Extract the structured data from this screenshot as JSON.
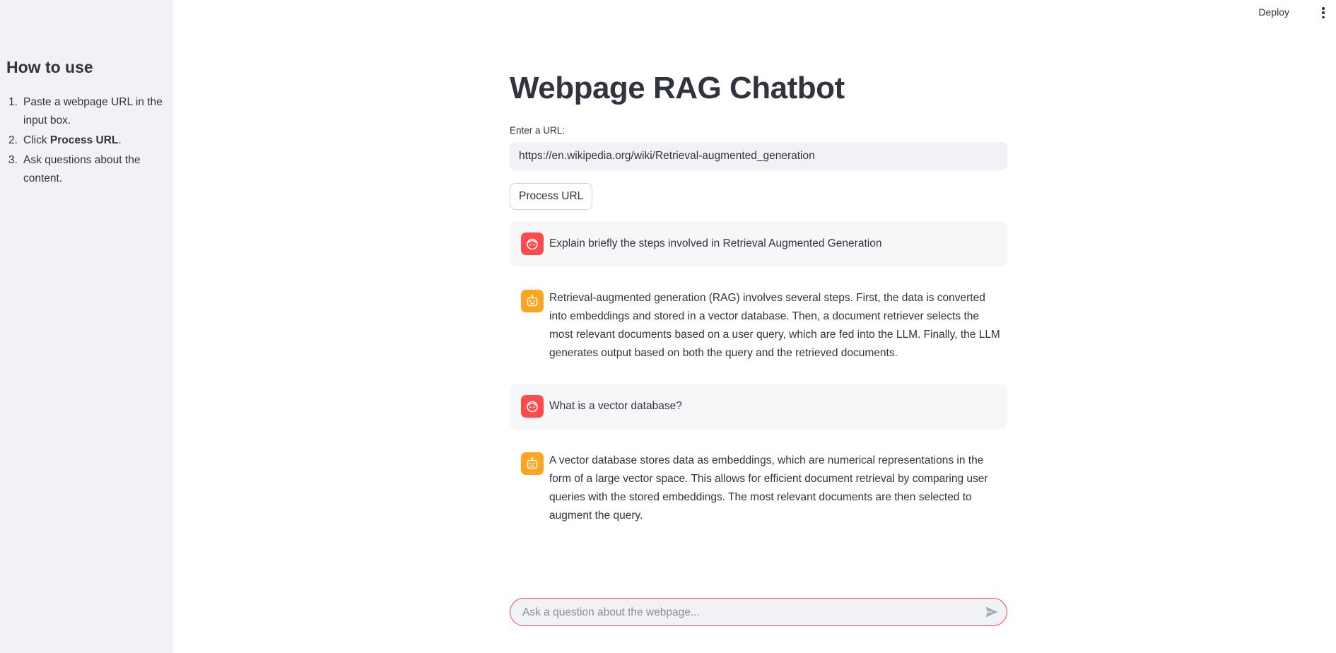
{
  "header": {
    "deploy_label": "Deploy",
    "menu_icon": "kebab-menu-icon"
  },
  "sidebar": {
    "title": "How to use",
    "steps": [
      {
        "num": "1.",
        "text": "Paste a webpage URL in the input box."
      },
      {
        "num": "2.",
        "prefix": "Click ",
        "bold": "Process URL",
        "suffix": "."
      },
      {
        "num": "3.",
        "text": "Ask questions about the content."
      }
    ]
  },
  "main": {
    "title": "Webpage RAG Chatbot",
    "url_label": "Enter a URL:",
    "url_value": "https://en.wikipedia.org/wiki/Retrieval-augmented_generation",
    "process_button": "Process URL"
  },
  "messages": [
    {
      "role": "user",
      "avatar_icon": "user-face-icon",
      "text": "Explain briefly the steps involved in Retrieval Augmented Generation"
    },
    {
      "role": "assistant",
      "avatar_icon": "robot-icon",
      "text": "Retrieval-augmented generation (RAG) involves several steps. First, the data is converted into embeddings and stored in a vector database. Then, a document retriever selects the most relevant documents based on a user query, which are fed into the LLM. Finally, the LLM generates output based on both the query and the retrieved documents."
    },
    {
      "role": "user",
      "avatar_icon": "user-face-icon",
      "text": "What is a vector database?"
    },
    {
      "role": "assistant",
      "avatar_icon": "robot-icon",
      "text": "A vector database stores data as embeddings, which are numerical representations in the form of a large vector space. This allows for efficient document retrieval by comparing user queries with the stored embeddings. The most relevant documents are then selected to augment the query."
    }
  ],
  "chat_input": {
    "placeholder": "Ask a question about the webpage...",
    "send_icon": "send-icon"
  },
  "colors": {
    "sidebar_bg": "#f0f2f6",
    "user_avatar": "#ff4b4b",
    "assistant_avatar": "#ffa421",
    "accent_border": "#ff4b4b"
  }
}
